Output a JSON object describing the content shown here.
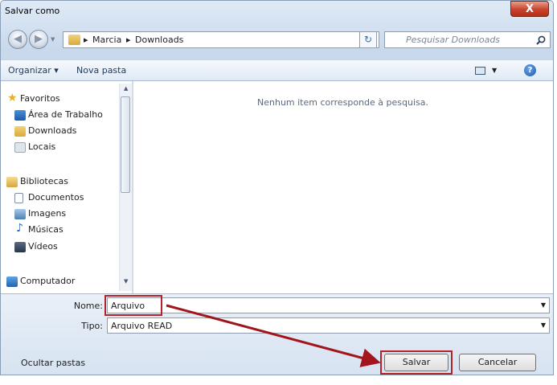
{
  "window": {
    "title": "Salvar como",
    "close_glyph": "X"
  },
  "breadcrumb": {
    "sep": "▸",
    "items": [
      "Marcia",
      "Downloads"
    ]
  },
  "search": {
    "placeholder": "Pesquisar Downloads"
  },
  "toolbar": {
    "organize": "Organizar ▾",
    "new_folder": "Nova pasta"
  },
  "sidebar": {
    "items": [
      {
        "label": "Favoritos",
        "icon": "star-icon"
      },
      {
        "label": "Área de Trabalho",
        "icon": "desktop-icon"
      },
      {
        "label": "Downloads",
        "icon": "downloads-folder-icon"
      },
      {
        "label": "Locais",
        "icon": "recent-places-icon"
      },
      {
        "label": "Bibliotecas",
        "icon": "libraries-icon"
      },
      {
        "label": "Documentos",
        "icon": "documents-icon"
      },
      {
        "label": "Imagens",
        "icon": "pictures-icon"
      },
      {
        "label": "Músicas",
        "icon": "music-icon"
      },
      {
        "label": "Vídeos",
        "icon": "videos-icon"
      },
      {
        "label": "Computador",
        "icon": "computer-icon"
      }
    ]
  },
  "main": {
    "empty_message": "Nenhum item corresponde à pesquisa."
  },
  "form": {
    "name_label": "Nome:",
    "name_value": "Arquivo",
    "type_label": "Tipo:",
    "type_value": "Arquivo READ"
  },
  "footer": {
    "hide_folders": "Ocultar pastas",
    "save": "Salvar",
    "cancel": "Cancelar"
  },
  "colors": {
    "highlight": "#b0242a",
    "arrow": "#a3151d"
  }
}
